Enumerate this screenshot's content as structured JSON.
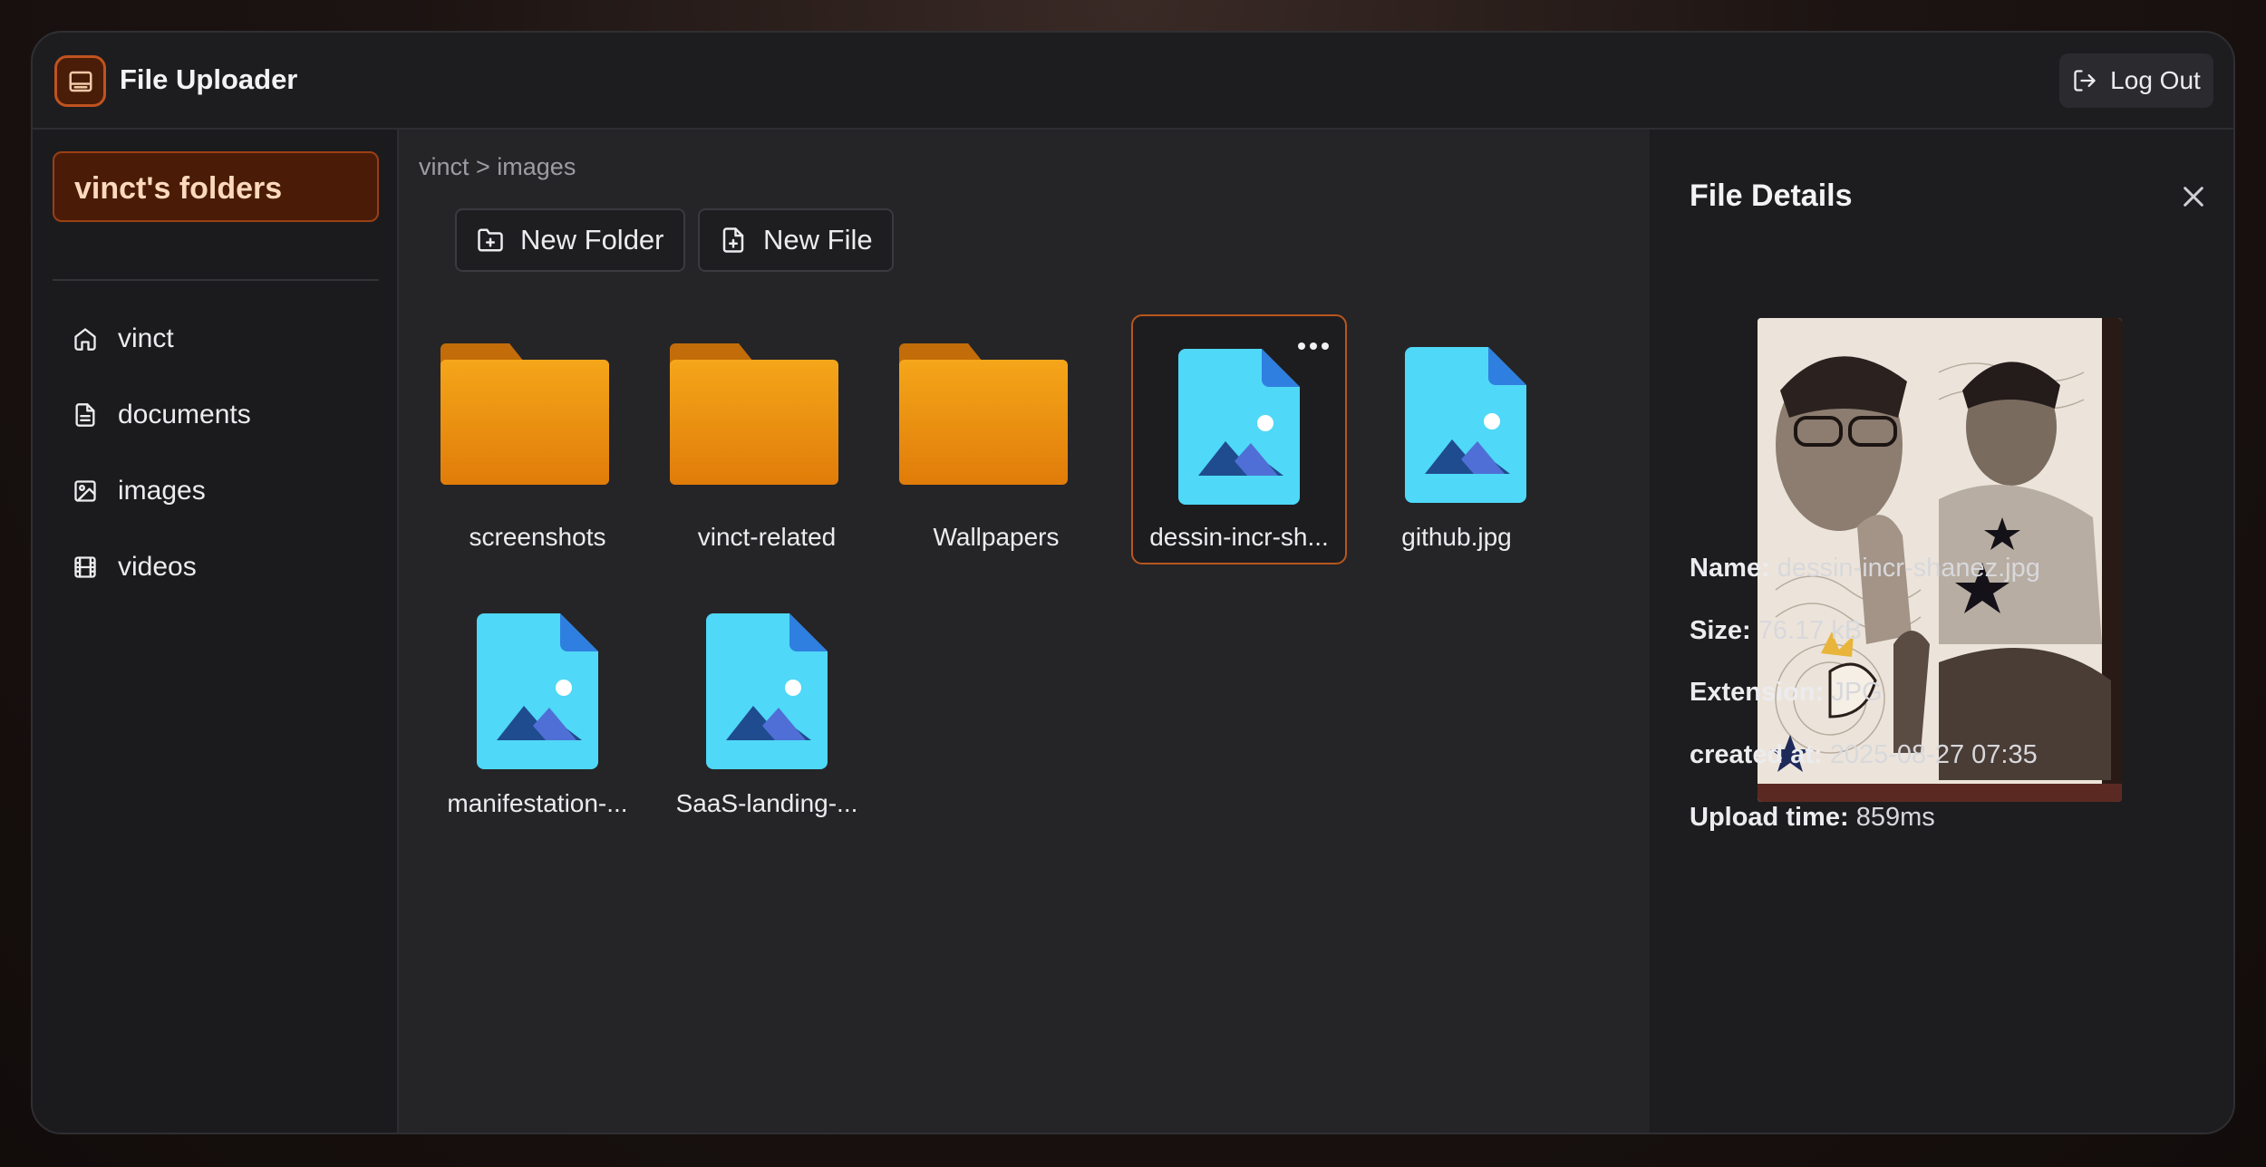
{
  "app": {
    "title": "File Uploader",
    "logout_label": "Log Out"
  },
  "sidebar": {
    "title": "vinct's folders",
    "items": [
      {
        "label": "vinct",
        "icon": "home-icon"
      },
      {
        "label": "documents",
        "icon": "document-icon"
      },
      {
        "label": "images",
        "icon": "image-icon"
      },
      {
        "label": "videos",
        "icon": "film-icon"
      }
    ]
  },
  "main": {
    "breadcrumb": "vinct > images",
    "new_folder_label": "New Folder",
    "new_file_label": "New File",
    "items": [
      {
        "label": "screenshots",
        "type": "folder"
      },
      {
        "label": "vinct-related",
        "type": "folder"
      },
      {
        "label": "Wallpapers",
        "type": "folder"
      },
      {
        "label": "dessin-incr-sh...",
        "type": "image",
        "selected": true
      },
      {
        "label": "github.jpg",
        "type": "image"
      },
      {
        "label": "manifestation-...",
        "type": "image"
      },
      {
        "label": "SaaS-landing-...",
        "type": "image"
      }
    ]
  },
  "details": {
    "title": "File Details",
    "name_label": "Name:",
    "name": "dessin-incr-shanez.jpg",
    "size_label": "Size:",
    "size": "76.17 kB",
    "extension_label": "Extension:",
    "extension": "JPG",
    "created_label": "created at:",
    "created": "2025-08-27 07:35",
    "upload_label": "Upload time:",
    "upload": "859ms"
  },
  "colors": {
    "accent": "#c0531f",
    "folder": "#f29a12",
    "image_file": "#4fd8f7"
  }
}
